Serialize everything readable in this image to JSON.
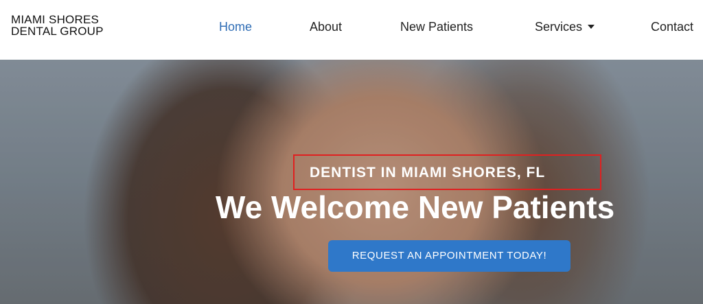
{
  "brand": {
    "line1": "MIAMI SHORES",
    "line2": "DENTAL GROUP"
  },
  "nav": {
    "items": [
      {
        "label": "Home",
        "active": true
      },
      {
        "label": "About"
      },
      {
        "label": "New Patients"
      },
      {
        "label": "Services",
        "has_dropdown": true
      },
      {
        "label": "Contact"
      }
    ]
  },
  "hero": {
    "eyebrow": "DENTIST IN MIAMI SHORES, FL",
    "headline": "We Welcome New Patients",
    "cta_label": "REQUEST AN APPOINTMENT TODAY!"
  },
  "colors": {
    "accent": "#2f78c9",
    "nav_active": "#2f6db5",
    "highlight_outline": "#e02020"
  },
  "icons": {
    "services_dropdown": "caret-down-icon"
  }
}
